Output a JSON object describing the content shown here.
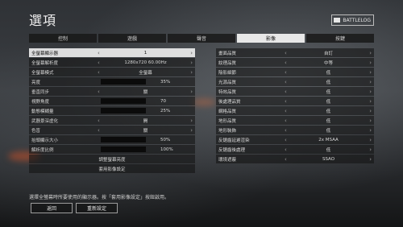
{
  "header": {
    "title": "選項",
    "battlelog_label": "BATTLELOG"
  },
  "tabs": [
    {
      "label": "控制"
    },
    {
      "label": "遊戲"
    },
    {
      "label": "聲音"
    },
    {
      "label": "影像",
      "active": true
    },
    {
      "label": "按鍵"
    }
  ],
  "left_settings": [
    {
      "label": "全螢幕顯示器",
      "value": "1",
      "selected": true
    },
    {
      "label": "全螢幕解析度",
      "value": "1280x720 60.00Hz"
    },
    {
      "label": "全螢幕模式",
      "value": "全螢幕"
    },
    {
      "label": "亮度",
      "value": "35%",
      "slider": true,
      "fill": 0.35
    },
    {
      "label": "垂直同步",
      "value": "關"
    },
    {
      "label": "視野角度",
      "value": "70",
      "slider": true,
      "fill": 0.2
    },
    {
      "label": "動態模糊量",
      "value": "25%",
      "slider": true,
      "fill": 0.25
    },
    {
      "label": "武器景深虛化",
      "value": "開"
    },
    {
      "label": "色盲",
      "value": "關"
    },
    {
      "label": "抬頭顯示大小",
      "value": "50%",
      "slider": true,
      "fill": 0.5
    },
    {
      "label": "解析度比例",
      "value": "100%",
      "slider": true,
      "fill": 1.0
    }
  ],
  "left_buttons": {
    "brightness": "調整螢幕亮度",
    "apply": "套用影像設定"
  },
  "right_settings": [
    {
      "label": "畫面品質",
      "value": "自訂"
    },
    {
      "label": "紋理品質",
      "value": "中等"
    },
    {
      "label": "陰影細節",
      "value": "低"
    },
    {
      "label": "光源品質",
      "value": "低"
    },
    {
      "label": "特效品質",
      "value": "低"
    },
    {
      "label": "後處理品質",
      "value": "低"
    },
    {
      "label": "網格品質",
      "value": "低"
    },
    {
      "label": "地形品質",
      "value": "低"
    },
    {
      "label": "地形裝飾",
      "value": "低"
    },
    {
      "label": "反鋸齒延遲渲染",
      "value": "2x MSAA"
    },
    {
      "label": "反鋸齒後處理",
      "value": "低"
    },
    {
      "label": "環境遮蔽",
      "value": "SSAO"
    }
  ],
  "footer": {
    "note": "選擇全螢幕時所要使用的顯示器。按「套用影像設定」按鈕啟用。",
    "back_label": "返回",
    "reset_label": "重新設定"
  }
}
